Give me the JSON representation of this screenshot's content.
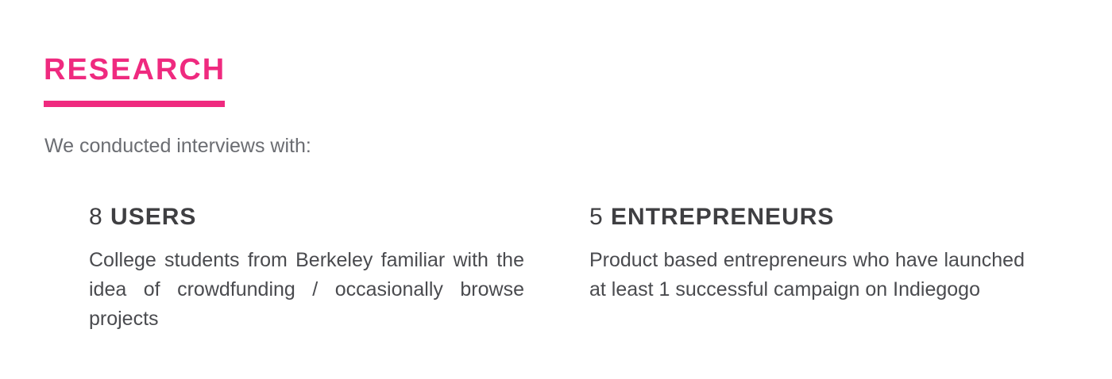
{
  "section": {
    "title": "RESEARCH",
    "accent_color": "#ef2a7f",
    "intro": "We conducted interviews with:"
  },
  "groups": [
    {
      "count": "8",
      "label": "USERS",
      "description": "College students from Berkeley familiar with the idea of crowdfunding / occasionally browse projects"
    },
    {
      "count": "5",
      "label": "ENTREPRENEURS",
      "description": "Product based entrepreneurs who have launched at least 1 successful campaign on Indiegogo"
    }
  ]
}
